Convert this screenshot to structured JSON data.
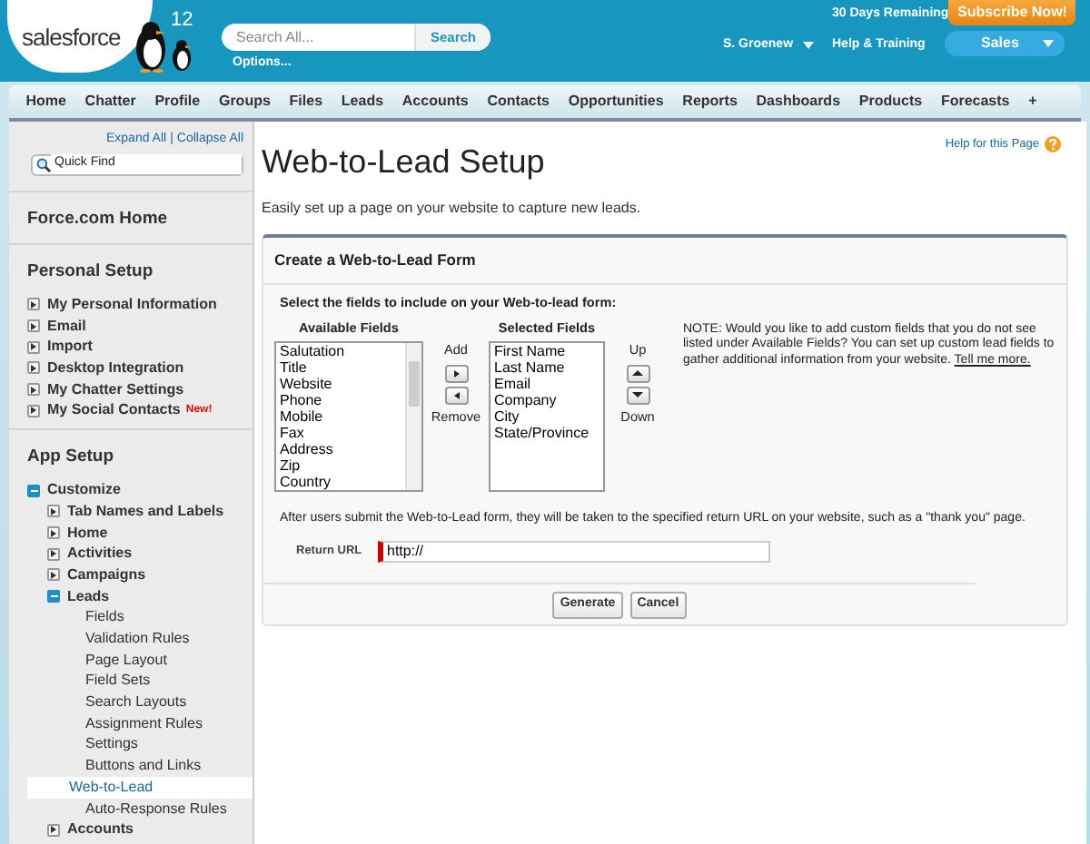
{
  "header": {
    "logo": "salesforce",
    "version": "12",
    "search": {
      "placeholder": "Search All...",
      "button": "Search",
      "options": "Options..."
    },
    "trial": "30 Days Remaining",
    "subscribe": "Subscribe Now!",
    "user": "S. Groenew",
    "help": "Help & Training",
    "app": "Sales"
  },
  "tabs": [
    {
      "label": "Home",
      "selected": false
    },
    {
      "label": "Chatter",
      "selected": false
    },
    {
      "label": "Profile",
      "selected": false
    },
    {
      "label": "Groups",
      "selected": false
    },
    {
      "label": "Files",
      "selected": false
    },
    {
      "label": "Leads",
      "selected": false
    },
    {
      "label": "Accounts",
      "selected": false
    },
    {
      "label": "Contacts",
      "selected": false
    },
    {
      "label": "Opportunities",
      "selected": false
    },
    {
      "label": "Reports",
      "selected": false
    },
    {
      "label": "Dashboards",
      "selected": false
    },
    {
      "label": "Products",
      "selected": false
    },
    {
      "label": "Forecasts",
      "selected": false
    },
    {
      "label": "+",
      "selected": false
    }
  ],
  "sidebar": {
    "expand_all": "Expand All",
    "separator": "|",
    "collapse_all": "Collapse All",
    "quick_find": {
      "placeholder": "Quick Find"
    },
    "sections": [
      {
        "title": "Force.com Home"
      },
      {
        "title": "Personal Setup",
        "items": [
          {
            "label": "My Personal Information",
            "expanded": false,
            "selected": false
          },
          {
            "label": "Email",
            "expanded": false,
            "selected": false
          },
          {
            "label": "Import",
            "expanded": false,
            "selected": false
          },
          {
            "label": "Desktop Integration",
            "expanded": false,
            "selected": false
          },
          {
            "label": "My Chatter Settings",
            "expanded": false,
            "selected": false
          },
          {
            "label": "My Social Contacts",
            "badge": "New!",
            "expanded": false,
            "selected": false
          }
        ]
      },
      {
        "title": "App Setup",
        "items": [
          {
            "label": "Customize",
            "expanded": true,
            "selected": false,
            "children": [
              {
                "label": "Tab Names and Labels",
                "expanded": false,
                "selected": false
              },
              {
                "label": "Home",
                "expanded": false,
                "selected": false
              },
              {
                "label": "Activities",
                "expanded": false,
                "selected": false
              },
              {
                "label": "Campaigns",
                "expanded": false,
                "selected": false
              },
              {
                "label": "Leads",
                "expanded": true,
                "selected": false,
                "children": [
                  {
                    "label": "Fields",
                    "selected": false
                  },
                  {
                    "label": "Validation Rules",
                    "selected": false
                  },
                  {
                    "label": "Page Layout",
                    "selected": false
                  },
                  {
                    "label": "Field Sets",
                    "selected": false
                  },
                  {
                    "label": "Search Layouts",
                    "selected": false
                  },
                  {
                    "label": "Assignment Rules",
                    "selected": false
                  },
                  {
                    "label": "Settings",
                    "selected": false
                  },
                  {
                    "label": "Buttons and Links",
                    "selected": false
                  },
                  {
                    "label": "Web-to-Lead",
                    "selected": true
                  },
                  {
                    "label": "Auto-Response Rules",
                    "selected": false
                  }
                ]
              },
              {
                "label": "Accounts",
                "expanded": false,
                "selected": false
              }
            ]
          }
        ]
      }
    ]
  },
  "main": {
    "title": "Web-to-Lead Setup",
    "help": "Help for this Page",
    "intro": "Easily set up a page on your website to capture new leads.",
    "panel": {
      "title": "Create a Web-to-Lead Form",
      "instruction": "Select the fields to include on your Web-to-lead form:",
      "available": {
        "label": "Available Fields",
        "options": [
          "Salutation",
          "Title",
          "Website",
          "Phone",
          "Mobile",
          "Fax",
          "Address",
          "Zip",
          "Country"
        ]
      },
      "add": "Add",
      "remove": "Remove",
      "selected": {
        "label": "Selected Fields",
        "options": [
          "First Name",
          "Last Name",
          "Email",
          "Company",
          "City",
          "State/Province"
        ]
      },
      "up": "Up",
      "down": "Down",
      "note": "NOTE: Would you like to add custom fields that you do not see listed under Available Fields? You can set up custom lead fields to gather additional information from your website.",
      "note_link": "Tell me more.",
      "after": "After users submit the Web-to-Lead form, they will be taken to the specified return URL on your website, such as a \"thank you\" page.",
      "return_url": {
        "label": "Return URL",
        "value": "http://"
      },
      "buttons": [
        "Generate",
        "Cancel"
      ]
    }
  }
}
